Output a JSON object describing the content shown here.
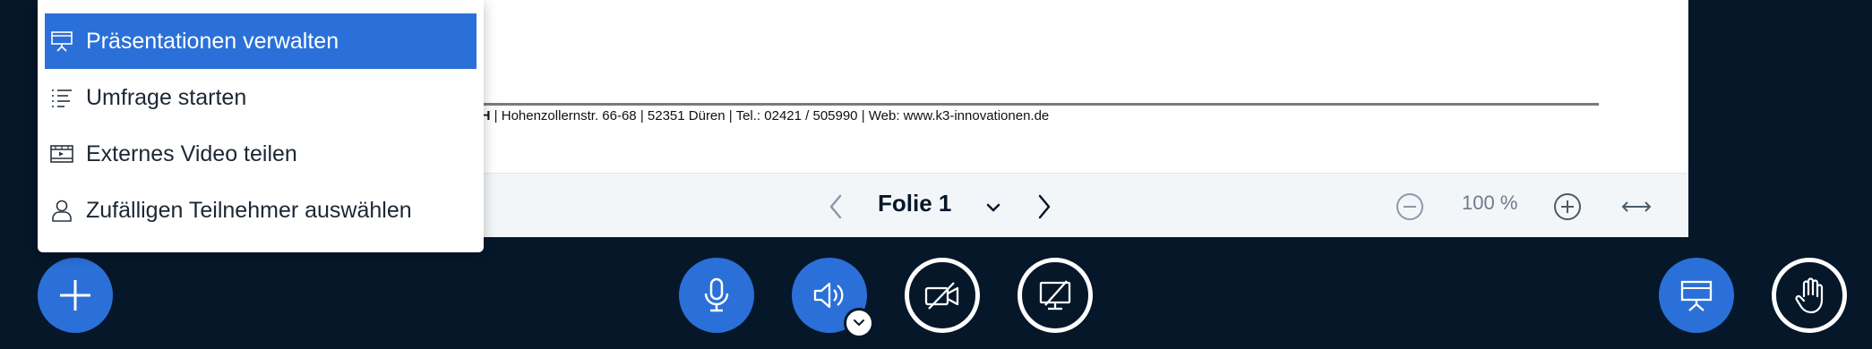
{
  "slide": {
    "footer_bold": "OH",
    "footer_text": " |  Hohenzollernstr. 66-68  |  52351 Düren  |  Tel.: 02421 / 505990  |  Web: www.k3-innovationen.de"
  },
  "toolbar": {
    "slide_label": "Folie 1",
    "zoom_value": "100 %"
  },
  "menu": {
    "items": [
      {
        "label": "Präsentationen verwalten",
        "icon": "presentation-icon",
        "active": true
      },
      {
        "label": "Umfrage starten",
        "icon": "poll-list-icon",
        "active": false
      },
      {
        "label": "Externes Video teilen",
        "icon": "video-film-icon",
        "active": false
      },
      {
        "label": "Zufälligen Teilnehmer auswählen",
        "icon": "user-icon",
        "active": false
      }
    ]
  },
  "actions": {
    "plus": "plus-icon",
    "microphone": "microphone-icon",
    "audio": "speaker-icon",
    "camera": "camera-off-icon",
    "screenshare": "screenshare-off-icon",
    "presentation": "presentation-icon",
    "raise_hand": "hand-icon"
  },
  "colors": {
    "background": "#06172A",
    "accent": "#2B70D8",
    "toolbar": "#F3F6F9"
  }
}
